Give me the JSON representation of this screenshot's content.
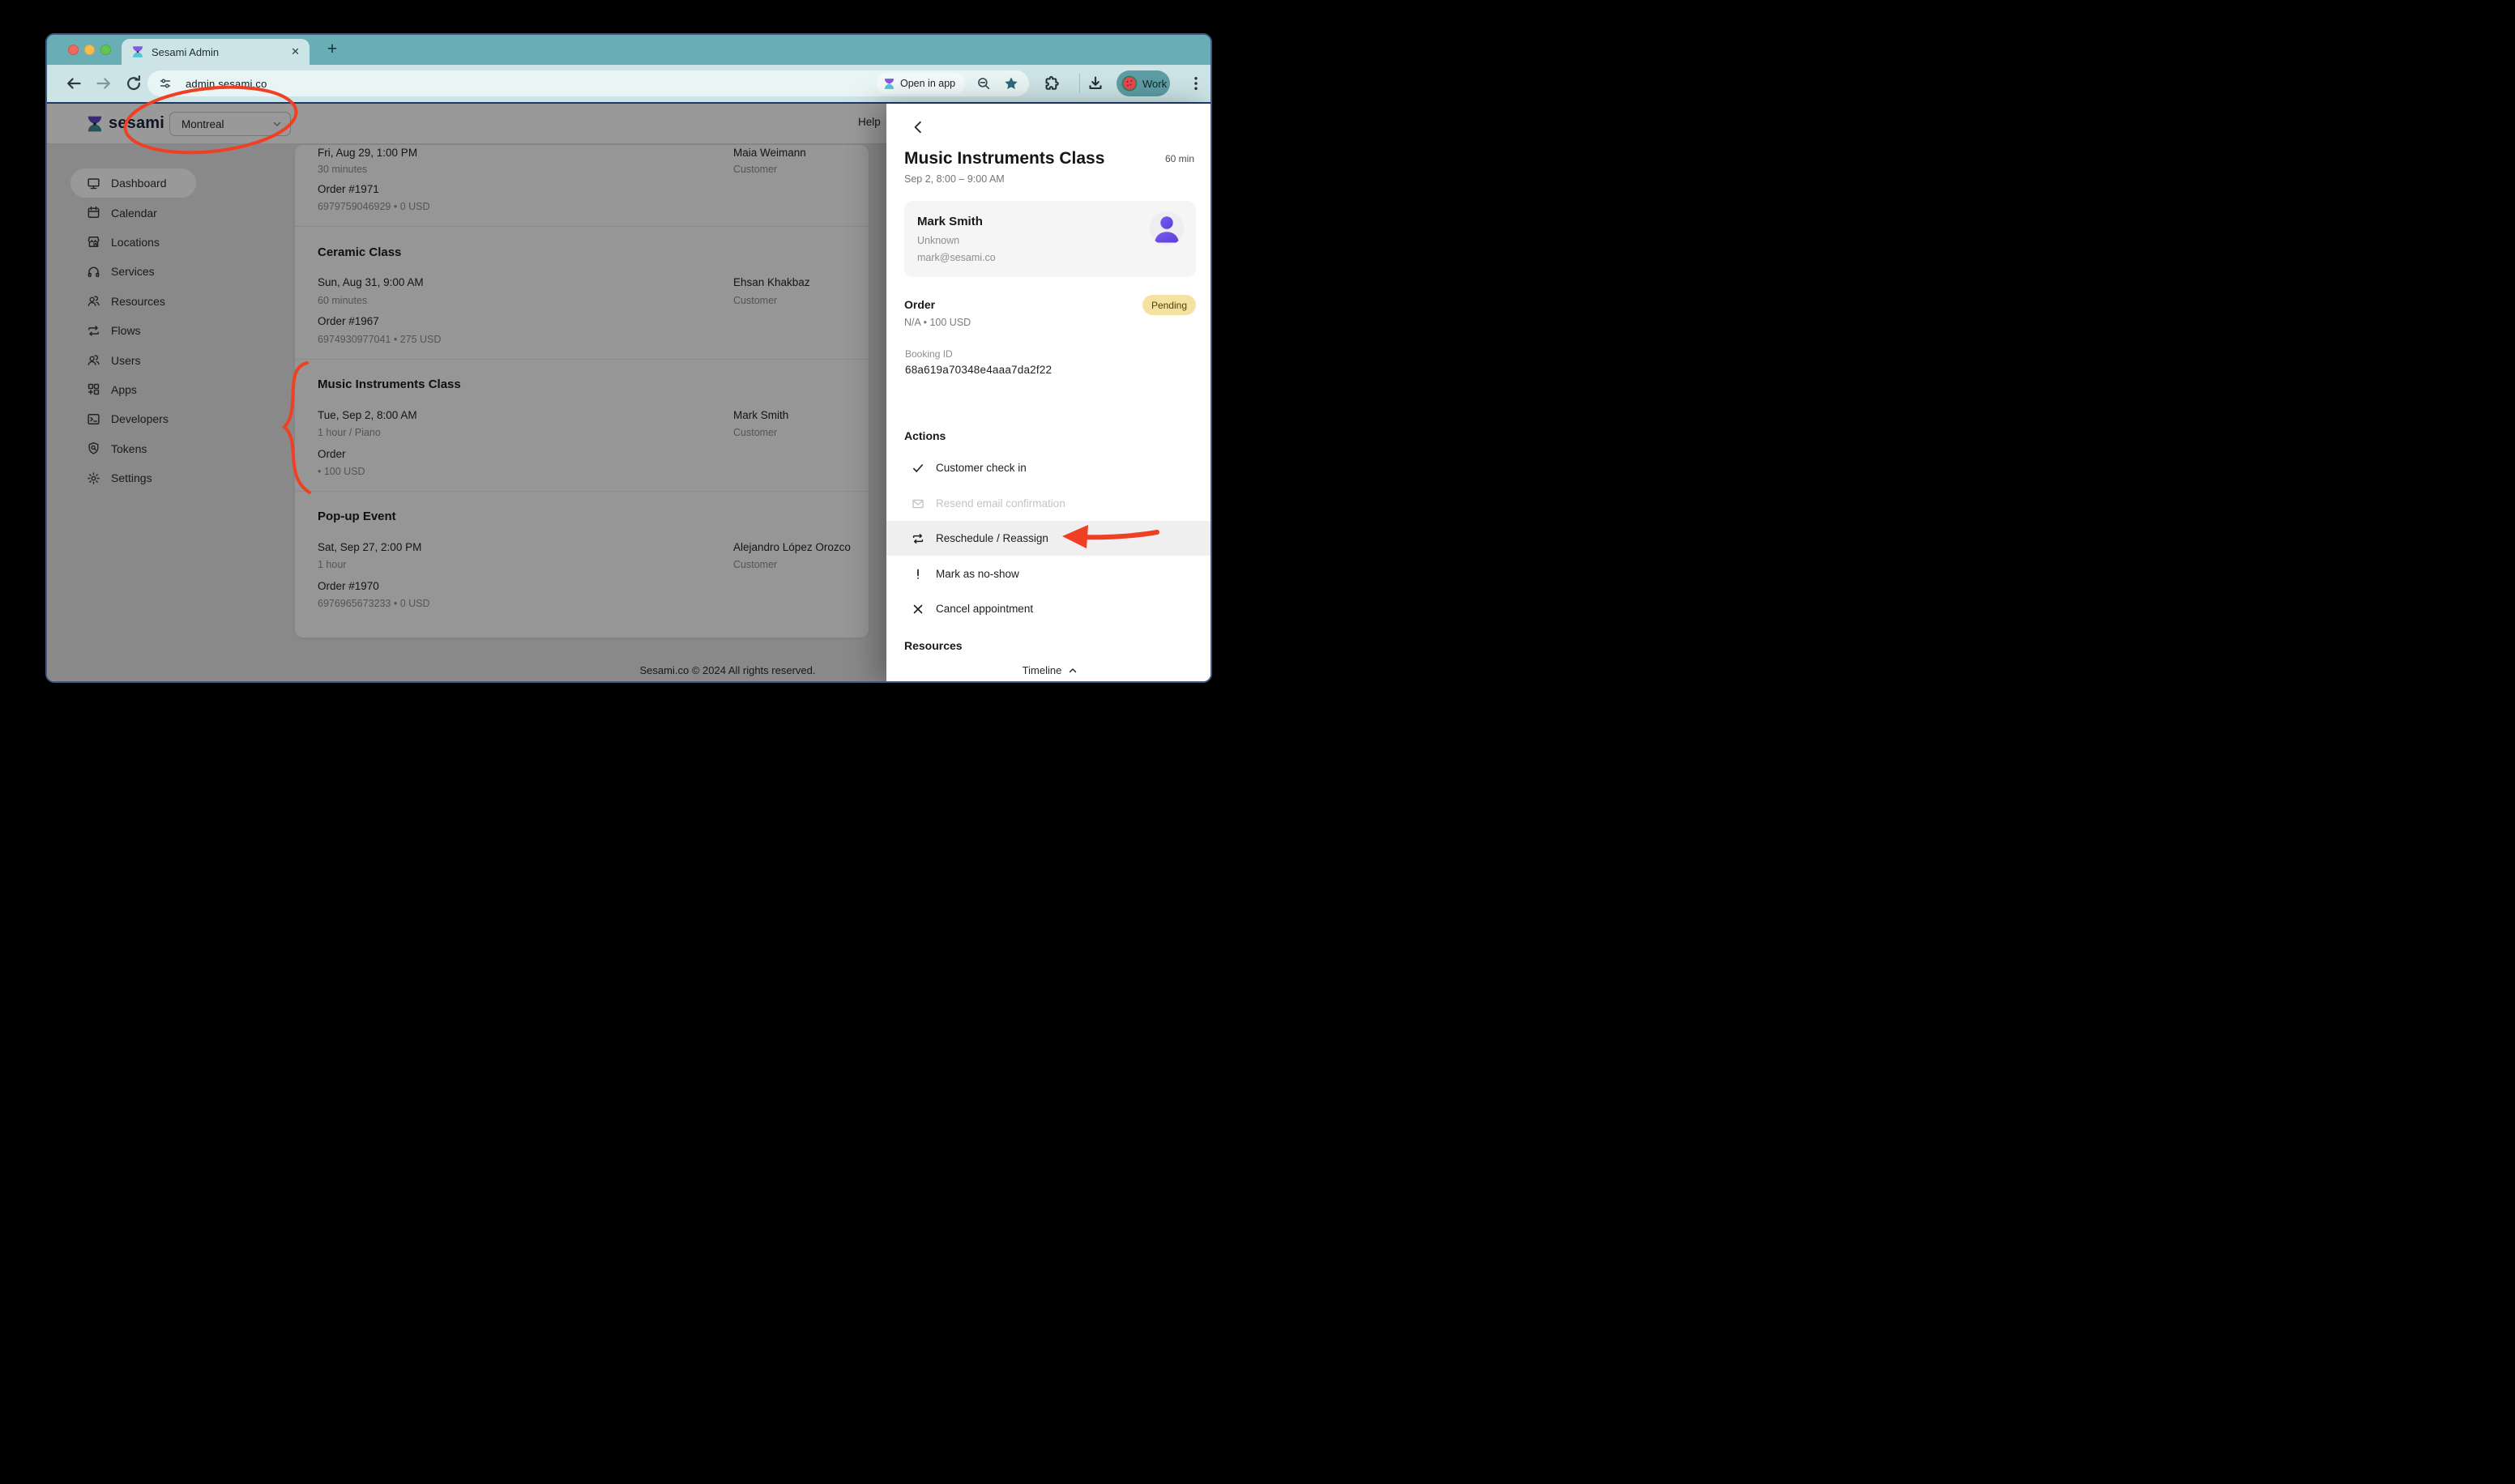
{
  "browser": {
    "tab_title": "Sesami Admin",
    "close_glyph": "✕",
    "new_tab_glyph": "+",
    "url": "admin.sesami.co",
    "open_in_app_label": "Open in app",
    "profile_label": "Work"
  },
  "header": {
    "brand": "sesami",
    "location": "Montreal",
    "help": "Help"
  },
  "sidebar": {
    "items": [
      {
        "label": "Dashboard"
      },
      {
        "label": "Calendar"
      },
      {
        "label": "Locations"
      },
      {
        "label": "Services"
      },
      {
        "label": "Resources"
      },
      {
        "label": "Flows"
      },
      {
        "label": "Users"
      },
      {
        "label": "Apps"
      },
      {
        "label": "Developers"
      },
      {
        "label": "Tokens"
      },
      {
        "label": "Settings"
      }
    ]
  },
  "list": {
    "sections": [
      {
        "title": "",
        "row": {
          "datetime": "Fri, Aug 29, 1:00 PM",
          "duration": "30 minutes",
          "order": "Order #1971",
          "order_meta": "6979759046929 • 0 USD",
          "customer": "Maia Weimann",
          "customer_role": "Customer"
        }
      },
      {
        "title": "Ceramic Class",
        "row": {
          "datetime": "Sun, Aug 31, 9:00 AM",
          "duration": "60 minutes",
          "order": "Order #1967",
          "order_meta": "6974930977041 • 275 USD",
          "customer": "Ehsan Khakbaz",
          "customer_role": "Customer"
        }
      },
      {
        "title": "Music Instruments Class",
        "row": {
          "datetime": "Tue, Sep 2, 8:00 AM",
          "duration": "1 hour / Piano",
          "order": "Order",
          "order_meta": "• 100 USD",
          "customer": "Mark Smith",
          "customer_role": "Customer"
        }
      },
      {
        "title": "Pop-up Event",
        "row": {
          "datetime": "Sat, Sep 27, 2:00 PM",
          "duration": "1 hour",
          "order": "Order #1970",
          "order_meta": "6976965673233 • 0 USD",
          "customer": "Alejandro López Orozco",
          "customer_role": "Customer"
        }
      }
    ]
  },
  "footer": {
    "copyright": "Sesami.co © 2024  All rights reserved."
  },
  "panel": {
    "title": "Music Instruments Class",
    "duration": "60 min",
    "time_range": "Sep 2, 8:00 – 9:00 AM",
    "customer": {
      "name": "Mark Smith",
      "status": "Unknown",
      "email": "mark@sesami.co"
    },
    "order": {
      "label": "Order",
      "badge": "Pending",
      "meta": "N/A • 100 USD",
      "booking_id_label": "Booking ID",
      "booking_id": "68a619a70348e4aaa7da2f22"
    },
    "actions": {
      "label": "Actions",
      "items": [
        {
          "label": "Customer check in"
        },
        {
          "label": "Resend email confirmation"
        },
        {
          "label": "Reschedule / Reassign"
        },
        {
          "label": "Mark as no-show"
        },
        {
          "label": "Cancel appointment"
        }
      ]
    },
    "resources_label": "Resources",
    "timeline_label": "Timeline"
  },
  "colors": {
    "annotation_red": "#ef4023",
    "pending_badge_bg": "#f6e2a0",
    "chrome_teal": "#69adb5",
    "toolbar_teal": "#cde4e6",
    "accent_navy": "#1c3a66"
  }
}
